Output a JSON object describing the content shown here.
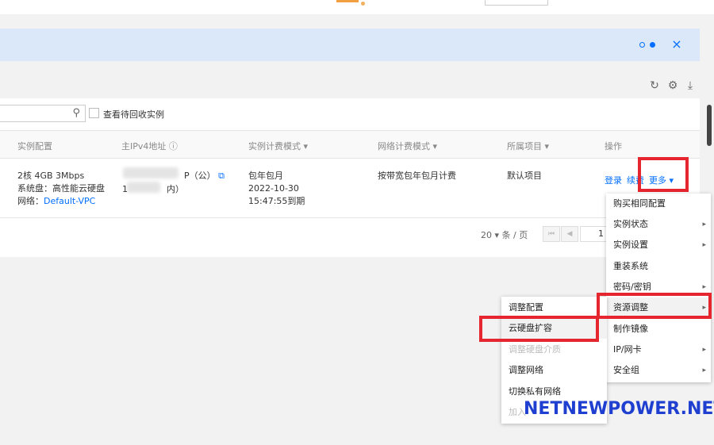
{
  "banner": {
    "close_icon": "×"
  },
  "toolbar": {
    "refresh_icon": "↻",
    "settings_icon": "⚙",
    "download_icon": "⤓"
  },
  "filter": {
    "search_icon": "⚲",
    "recycle_label": "查看待回收实例"
  },
  "table": {
    "headers": {
      "config": "实例配置",
      "ipv4": "主IPv4地址",
      "billing": "实例计费模式",
      "network_billing": "网络计费模式",
      "project": "所属项目",
      "actions": "操作"
    },
    "row": {
      "config_line1": "2核 4GB 3Mbps",
      "config_line2": "系统盘：高性能云硬盘",
      "network_label": "网络：",
      "network_value": "Default-VPC",
      "ip_line1_suffix": "P（公）",
      "ip_line2_prefix": "1",
      "ip_line2_suffix": "内）",
      "billing_line1": "包年包月",
      "billing_line2": "2022-10-30",
      "billing_line3": "15:47:55到期",
      "network_billing": "按带宽包年包月计费",
      "project": "默认项目",
      "action_login": "登录",
      "action_renew": "续费",
      "action_more": "更多 ▾"
    }
  },
  "pager": {
    "per_page": "20 ▾ 条 / 页",
    "first_icon": "⏮",
    "prev_icon": "◀",
    "page": "1"
  },
  "more_menu": {
    "items": [
      {
        "label": "购买相同配置",
        "arrow": ""
      },
      {
        "label": "实例状态",
        "arrow": "▸"
      },
      {
        "label": "实例设置",
        "arrow": "▸"
      },
      {
        "label": "重装系统",
        "arrow": ""
      },
      {
        "label": "密码/密钥",
        "arrow": "▸"
      },
      {
        "label": "资源调整",
        "arrow": "▸"
      },
      {
        "label": "制作镜像",
        "arrow": ""
      },
      {
        "label": "IP/网卡",
        "arrow": "▸"
      },
      {
        "label": "安全组",
        "arrow": "▸"
      }
    ]
  },
  "resource_menu": {
    "items": [
      {
        "label": "调整配置"
      },
      {
        "label": "云硬盘扩容"
      },
      {
        "label": "调整硬盘介质"
      },
      {
        "label": "调整网络"
      },
      {
        "label": "切换私有网络"
      },
      {
        "label": "加入"
      }
    ]
  },
  "watermark": "NETNEWPOWER.NET"
}
